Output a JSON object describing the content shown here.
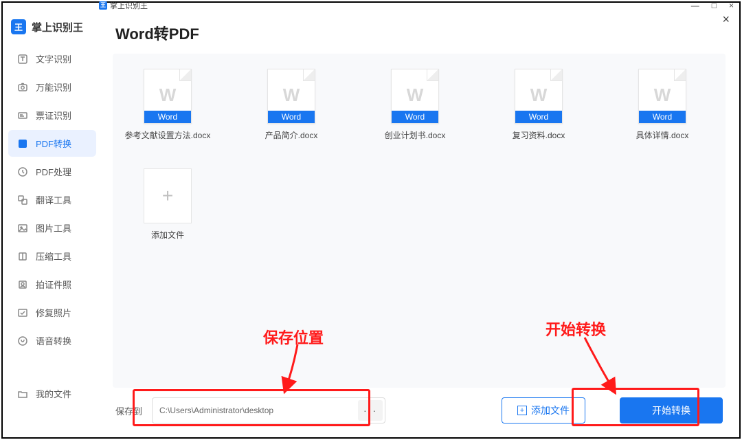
{
  "titlebar": {
    "title": "掌上识别王",
    "min": "—",
    "max": "□",
    "close": "×"
  },
  "brand": {
    "title": "掌上识别王",
    "icon_letter": "王"
  },
  "sidebar": {
    "items": [
      {
        "label": "文字识别"
      },
      {
        "label": "万能识别"
      },
      {
        "label": "票证识别"
      },
      {
        "label": "PDF转换"
      },
      {
        "label": "PDF处理"
      },
      {
        "label": "翻译工具"
      },
      {
        "label": "图片工具"
      },
      {
        "label": "压缩工具"
      },
      {
        "label": "拍证件照"
      },
      {
        "label": "修复照片"
      },
      {
        "label": "语音转换"
      }
    ],
    "my_files": "我的文件"
  },
  "page": {
    "title": "Word转PDF",
    "doc_badge": "Word",
    "files": [
      {
        "name": "参考文献设置方法.docx"
      },
      {
        "name": "产品简介.docx"
      },
      {
        "name": "创业计划书.docx"
      },
      {
        "name": "复习资料.docx"
      },
      {
        "name": "具体详情.docx"
      }
    ],
    "add_file_tile": "添加文件"
  },
  "bottom": {
    "save_label": "保存到",
    "path_value": "C:\\Users\\Administrator\\desktop",
    "browse": "···",
    "add_file": "添加文件",
    "start": "开始转换"
  },
  "annotations": {
    "save_location": "保存位置",
    "start_convert": "开始转换"
  },
  "close_x": "×"
}
